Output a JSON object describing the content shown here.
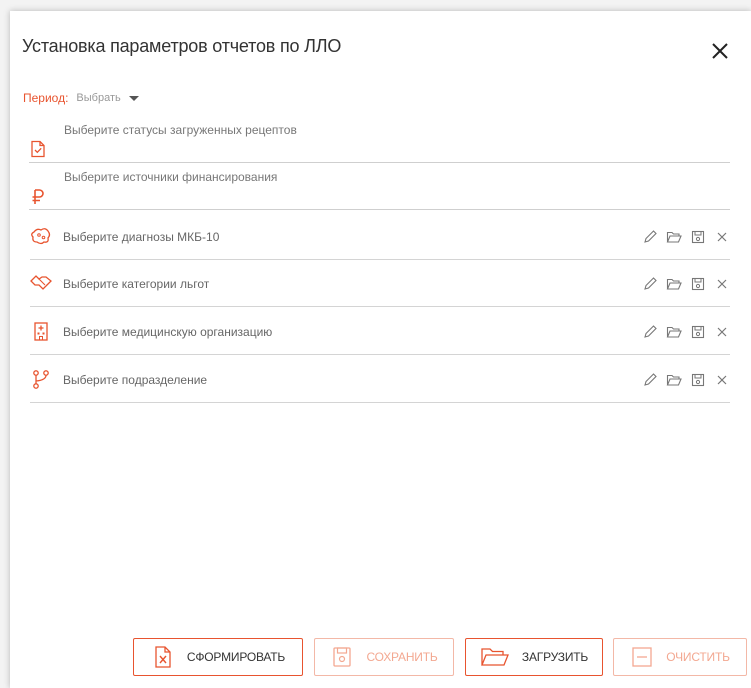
{
  "dialog": {
    "title": "Установка параметров отчетов по ЛЛО"
  },
  "period": {
    "label": "Период:",
    "value": "Выбрать"
  },
  "fields": {
    "statuses_placeholder": "Выберите статусы загруженных рецептов",
    "sources_placeholder": "Выберите источники финансирования"
  },
  "rows": [
    {
      "placeholder": "Выберите диагнозы МКБ-10",
      "icon": "virus-icon"
    },
    {
      "placeholder": "Выберите категории льгот",
      "icon": "handshake-icon"
    },
    {
      "placeholder": "Выберите медицинскую организацию",
      "icon": "hospital-icon"
    },
    {
      "placeholder": "Выберите подразделение",
      "icon": "branch-icon"
    }
  ],
  "buttons": {
    "generate": "СФОРМИРОВАТЬ",
    "save": "СОХРАНИТЬ",
    "load": "ЗАГРУЗИТЬ",
    "clear": "ОЧИСТИТЬ"
  },
  "colors": {
    "accent": "#e8542f",
    "accent_disabled": "#f3b8a7"
  }
}
